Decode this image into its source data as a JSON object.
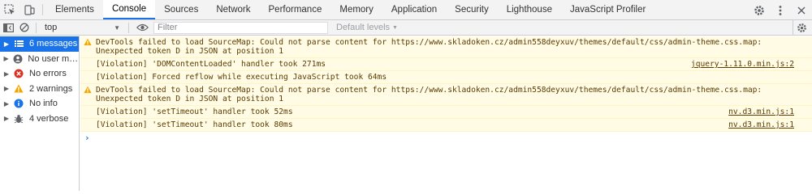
{
  "tabs": [
    "Elements",
    "Console",
    "Sources",
    "Network",
    "Performance",
    "Memory",
    "Application",
    "Security",
    "Lighthouse",
    "JavaScript Profiler"
  ],
  "active_tab": "Console",
  "toolbar": {
    "context": "top",
    "filter_placeholder": "Filter",
    "levels": "Default levels"
  },
  "sidebar": [
    {
      "label": "6 messages",
      "icon": "list-icon",
      "selected": true
    },
    {
      "label": "No user me...",
      "icon": "user-icon",
      "selected": false
    },
    {
      "label": "No errors",
      "icon": "error-icon",
      "selected": false
    },
    {
      "label": "2 warnings",
      "icon": "warning-icon",
      "selected": false
    },
    {
      "label": "No info",
      "icon": "info-icon",
      "selected": false
    },
    {
      "label": "4 verbose",
      "icon": "bug-icon",
      "selected": false
    }
  ],
  "messages": [
    {
      "warn": true,
      "pre": "DevTools failed to load SourceMap: Could not parse content for ",
      "link": "https://www.skladoken.cz/admin558deyxuv/themes/default/css/admin-theme.css.map",
      "post": ": Unexpected token D in JSON at position 1",
      "source": ""
    },
    {
      "warn": false,
      "pre": "[Violation] 'DOMContentLoaded' handler took 271ms",
      "link": "",
      "post": "",
      "source": "jquery-1.11.0.min.js:2"
    },
    {
      "warn": false,
      "pre": "[Violation] Forced reflow while executing JavaScript took 64ms",
      "link": "",
      "post": "",
      "source": ""
    },
    {
      "warn": true,
      "pre": "DevTools failed to load SourceMap: Could not parse content for ",
      "link": "https://www.skladoken.cz/admin558deyxuv/themes/default/css/admin-theme.css.map",
      "post": ": Unexpected token D in JSON at position 1",
      "source": ""
    },
    {
      "warn": false,
      "pre": "[Violation] 'setTimeout' handler took 52ms",
      "link": "",
      "post": "",
      "source": "nv.d3.min.js:1"
    },
    {
      "warn": false,
      "pre": "[Violation] 'setTimeout' handler took 80ms",
      "link": "",
      "post": "",
      "source": "nv.d3.min.js:1"
    }
  ],
  "prompt_symbol": "›",
  "colors": {
    "accent": "#1a73e8",
    "warning_bg": "#fffbe5",
    "warning_text": "#5c3c00"
  }
}
